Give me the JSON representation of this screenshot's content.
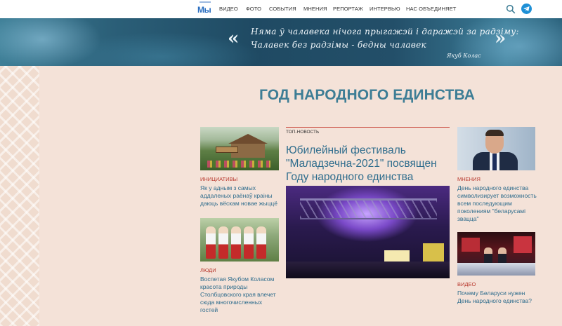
{
  "header": {
    "logo_text": "Мы",
    "nav": [
      "ВИДЕО",
      "ФОТО",
      "СОБЫТИЯ",
      "МНЕНИЯ",
      "РЕПОРТАЖ",
      "ИНТЕРВЬЮ",
      "НАС ОБЪЕДИНЯЕТ"
    ]
  },
  "banner": {
    "quote_open": "«",
    "quote_close": "»",
    "quote_lines": [
      "Няма ў чалавека нічога прыгажэй і даражэй за радзіму:",
      "Чалавек без радзімы - бедны чалавек"
    ],
    "author": "Якуб Колас"
  },
  "page": {
    "title": "ГОД НАРОДНОГО ЕДИНСТВА"
  },
  "left_column": [
    {
      "category": "ИНИЦИАТИВЫ",
      "headline": "Як у адным з самых аддаленых раёнаў краіны даюць вёскам новае жыццё"
    },
    {
      "category": "ЛЮДИ",
      "headline": "Воспетая Якубом Коласом красота природы Столбцовского края влечет сюда многочисленных гостей"
    }
  ],
  "top_news": {
    "label": "ТОП-НОВОСТЬ",
    "headline": "Юбилейный фестиваль \"Маладзечна-2021\" посвящен Году народного единства"
  },
  "right_column": [
    {
      "category": "МНЕНИЯ",
      "headline": "День народного единства символизирует возможность всем последующим поколениям \"беларусамі звацца\""
    },
    {
      "category": "ВИДЕО",
      "headline": "Почему Беларуси нужен День народного единства?"
    }
  ],
  "colors": {
    "accent_blue": "#3d7d95",
    "category_red": "#b8392e",
    "telegram": "#1e90d6"
  }
}
